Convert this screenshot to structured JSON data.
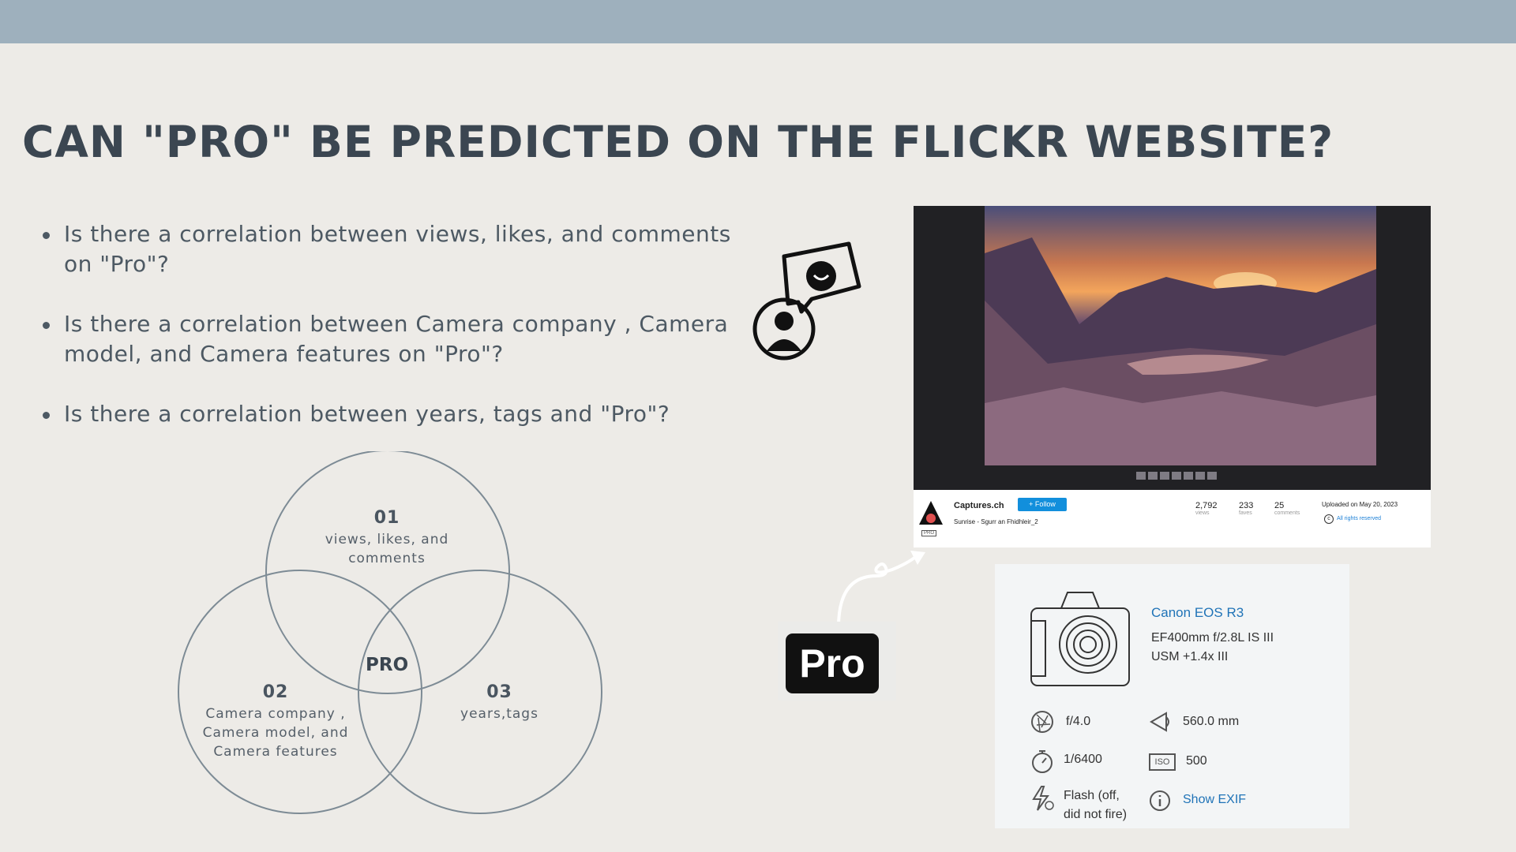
{
  "slide": {
    "title": "CAN \"PRO\" BE PREDICTED ON THE FLICKR WEBSITE?",
    "bullets": [
      "Is there a correlation between views, likes, and comments on \"Pro\"?",
      "Is there a correlation between Camera company , Camera model, and Camera  features on \"Pro\"?",
      "Is there a correlation between years, tags  and \"Pro\"?"
    ]
  },
  "venn": {
    "c1": {
      "num": "01",
      "text": "views, likes, and comments"
    },
    "c2": {
      "num": "02",
      "text": "Camera company , Camera model, and Camera features"
    },
    "c3": {
      "num": "03",
      "text": "years,tags"
    },
    "center": "PRO"
  },
  "flickr": {
    "author": "Captures.ch",
    "follow": "+ Follow",
    "photo_title": "Sunrise - Sgurr an Fhidhleir_2",
    "views": {
      "value": "2,792",
      "label": "views"
    },
    "faves": {
      "value": "233",
      "label": "faves"
    },
    "comments": {
      "value": "25",
      "label": "comments"
    },
    "uploaded": "Uploaded on May 20, 2023",
    "rights": "All rights reserved",
    "pro_mini": "PRO"
  },
  "exif": {
    "camera": "Canon EOS R3",
    "lens": "EF400mm f/2.8L IS III USM +1.4x III",
    "aperture": "f/4.0",
    "focal": "560.0 mm",
    "shutter": "1/6400",
    "iso": "500",
    "flash": "Flash (off, did not fire)",
    "show_exif": "Show EXIF",
    "iso_label": "ISO"
  },
  "badge": {
    "word": "Pro"
  },
  "colors": {
    "topbar": "#9eb0bd",
    "background": "#edebe7",
    "title": "#3b4651",
    "link": "#1f73b7",
    "follow": "#128fdc"
  }
}
